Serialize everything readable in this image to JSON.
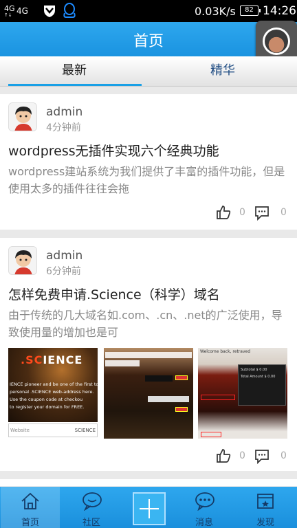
{
  "status_bar": {
    "network_top": "4G",
    "network_sub": "↑↓",
    "network_2": "4G",
    "speed": "0.03K/s",
    "battery": "82",
    "time": "14:26"
  },
  "header": {
    "title": "首页"
  },
  "tabs": [
    {
      "label": "最新",
      "active": true
    },
    {
      "label": "精华",
      "active": false
    }
  ],
  "posts": [
    {
      "username": "admin",
      "time": "4分钟前",
      "title": "wordpress无插件实现六个经典功能",
      "excerpt": "wordpress建站系统为我们提供了丰富的插件功能，但是使用太多的插件往往会拖",
      "likes": "0",
      "comments": "0"
    },
    {
      "username": "admin",
      "time": "6分钟前",
      "title": "怎样免费申请.Science（科学）域名",
      "excerpt": "由于传统的几大域名如.com、.cn、.net的广泛使用，导致使用量的增加也是可",
      "likes": "0",
      "comments": "0",
      "thumbnails": {
        "t1_logo_a": ".SC",
        "t1_logo_b": "IENCE",
        "t1_line1": "IENCE pioneer and be one of the first to regi",
        "t1_line2": "personal .SCIENCE web-address here.",
        "t1_line3": "Use the              coupon code at checkou",
        "t1_line4": "to register your domain for FREE.",
        "t1_input": "Website",
        "t1_input_tld": "SCIENCE",
        "t3_header": "Welcome back, retraved",
        "t3_row1": "Subtotal  $ 0.00",
        "t3_row2": "Total Amount $ 0.00"
      }
    }
  ],
  "bottom_nav": [
    {
      "label": "首页",
      "icon": "home-icon"
    },
    {
      "label": "社区",
      "icon": "chat-bubble-icon"
    },
    {
      "label": "",
      "icon": "plus-icon"
    },
    {
      "label": "消息",
      "icon": "message-icon"
    },
    {
      "label": "发现",
      "icon": "discover-icon"
    }
  ],
  "colors": {
    "primary_blue": "#1a93e0",
    "tab_active_indicator": "#1aa0e6",
    "tab_inactive_text": "#1e4b82"
  }
}
